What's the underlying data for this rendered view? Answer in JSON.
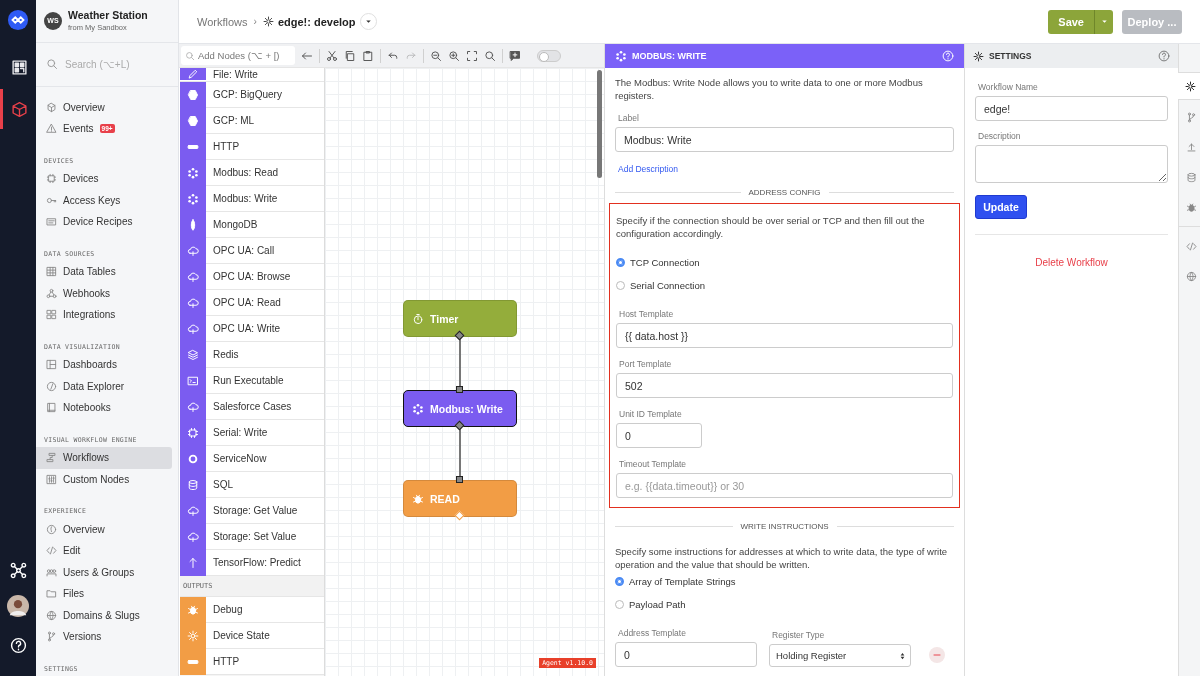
{
  "rail": {
    "items": [
      {
        "selected": false
      },
      {
        "selected": true
      }
    ]
  },
  "app": {
    "initials": "WS",
    "title": "Weather Station",
    "subtitle": "from My Sandbox"
  },
  "search": {
    "placeholder": "Search (⌥+L)"
  },
  "nav_sections": [
    {
      "items": [
        {
          "label": "Overview",
          "selected": false
        },
        {
          "label": "Events",
          "selected": false,
          "badge": "99+"
        }
      ]
    },
    {
      "heading": "DEVICES",
      "items": [
        {
          "label": "Devices",
          "selected": false
        },
        {
          "label": "Access Keys",
          "selected": false
        },
        {
          "label": "Device Recipes",
          "selected": false
        }
      ]
    },
    {
      "heading": "DATA SOURCES",
      "items": [
        {
          "label": "Data Tables",
          "selected": false
        },
        {
          "label": "Webhooks",
          "selected": false
        },
        {
          "label": "Integrations",
          "selected": false
        }
      ]
    },
    {
      "heading": "DATA VISUALIZATION",
      "items": [
        {
          "label": "Dashboards",
          "selected": false
        },
        {
          "label": "Data Explorer",
          "selected": false
        },
        {
          "label": "Notebooks",
          "selected": false
        }
      ]
    },
    {
      "heading": "VISUAL WORKFLOW ENGINE",
      "items": [
        {
          "label": "Workflows",
          "selected": true
        },
        {
          "label": "Custom Nodes",
          "selected": false
        }
      ]
    },
    {
      "heading": "EXPERIENCE",
      "items": [
        {
          "label": "Overview",
          "selected": false
        },
        {
          "label": "Edit",
          "selected": false
        },
        {
          "label": "Users & Groups",
          "selected": false
        },
        {
          "label": "Files",
          "selected": false
        },
        {
          "label": "Domains & Slugs",
          "selected": false
        },
        {
          "label": "Versions",
          "selected": false
        }
      ]
    },
    {
      "heading": "SETTINGS"
    }
  ],
  "breadcrumb": {
    "parent": "Workflows",
    "separator": "›",
    "current": "edge!: develop"
  },
  "actions": {
    "save": "Save",
    "deploy": {
      "label": "Deploy ...",
      "disabled": true
    }
  },
  "toolbar": {
    "placeholder": "Add Nodes (⌥ + [)",
    "redo_disabled": true,
    "toggle_on": false
  },
  "palette": [
    {
      "color": "#7b5cf0",
      "items": [
        "File: Write",
        "GCP: BigQuery",
        "GCP: ML",
        "HTTP",
        "Modbus: Read",
        "Modbus: Write",
        "MongoDB",
        "OPC UA: Call",
        "OPC UA: Browse",
        "OPC UA: Read",
        "OPC UA: Write",
        "Redis",
        "Run Executable",
        "Salesforce Cases",
        "Serial: Write",
        "ServiceNow",
        "SQL",
        "Storage: Get Value",
        "Storage: Set Value",
        "TensorFlow: Predict"
      ]
    },
    {
      "heading": "OUTPUTS",
      "color": "#f29d45",
      "items": [
        "Debug",
        "Device State",
        "HTTP"
      ]
    }
  ],
  "canvas": {
    "nodes": [
      {
        "label": "Timer",
        "color": "#94ad3b",
        "selected": false
      },
      {
        "label": "Modbus: Write",
        "color": "#7b5cf0",
        "selected": true
      },
      {
        "label": "READ",
        "color": "#f29d45",
        "selected": false
      }
    ],
    "agent": "Agent v1.10.0"
  },
  "node_panel": {
    "title": "MODBUS: WRITE",
    "intro": "The Modbus: Write Node allows you to write data to one or more Modbus registers.",
    "label_field": {
      "label": "Label",
      "value": "Modbus: Write"
    },
    "add_description": "Add Description",
    "address": {
      "heading": "ADDRESS CONFIG",
      "highlighted": true,
      "intro": "Specify if the connection should be over serial or TCP and then fill out the configuration accordingly.",
      "options": [
        {
          "label": "TCP Connection",
          "selected": true
        },
        {
          "label": "Serial Connection",
          "selected": false
        }
      ],
      "fields": [
        {
          "label": "Host Template",
          "value": "{{ data.host }}"
        },
        {
          "label": "Port Template",
          "value": "502"
        },
        {
          "label": "Unit ID Template",
          "value": "0"
        },
        {
          "label": "Timeout Template",
          "placeholder": "e.g. {{data.timeout}} or 30"
        }
      ]
    },
    "write": {
      "heading": "WRITE INSTRUCTIONS",
      "intro": "Specify some instructions for addresses at which to write data, the type of write operation and the value that should be written.",
      "options": [
        {
          "label": "Array of Template Strings",
          "selected": true
        },
        {
          "label": "Payload Path",
          "selected": false
        }
      ],
      "address_label": "Address Template",
      "address_value": "0",
      "register_label": "Register Type",
      "register_value": "Holding Register"
    }
  },
  "settings": {
    "title": "SETTINGS",
    "name_label": "Workflow Name",
    "name_value": "edge!",
    "description_label": "Description",
    "update": "Update",
    "delete": "Delete Workflow"
  },
  "side_tabs": [
    {
      "selected": true
    },
    {
      "selected": false
    },
    {
      "selected": false
    },
    {
      "selected": false
    },
    {
      "selected": false
    },
    {
      "selected": false
    },
    {
      "selected": false
    }
  ]
}
